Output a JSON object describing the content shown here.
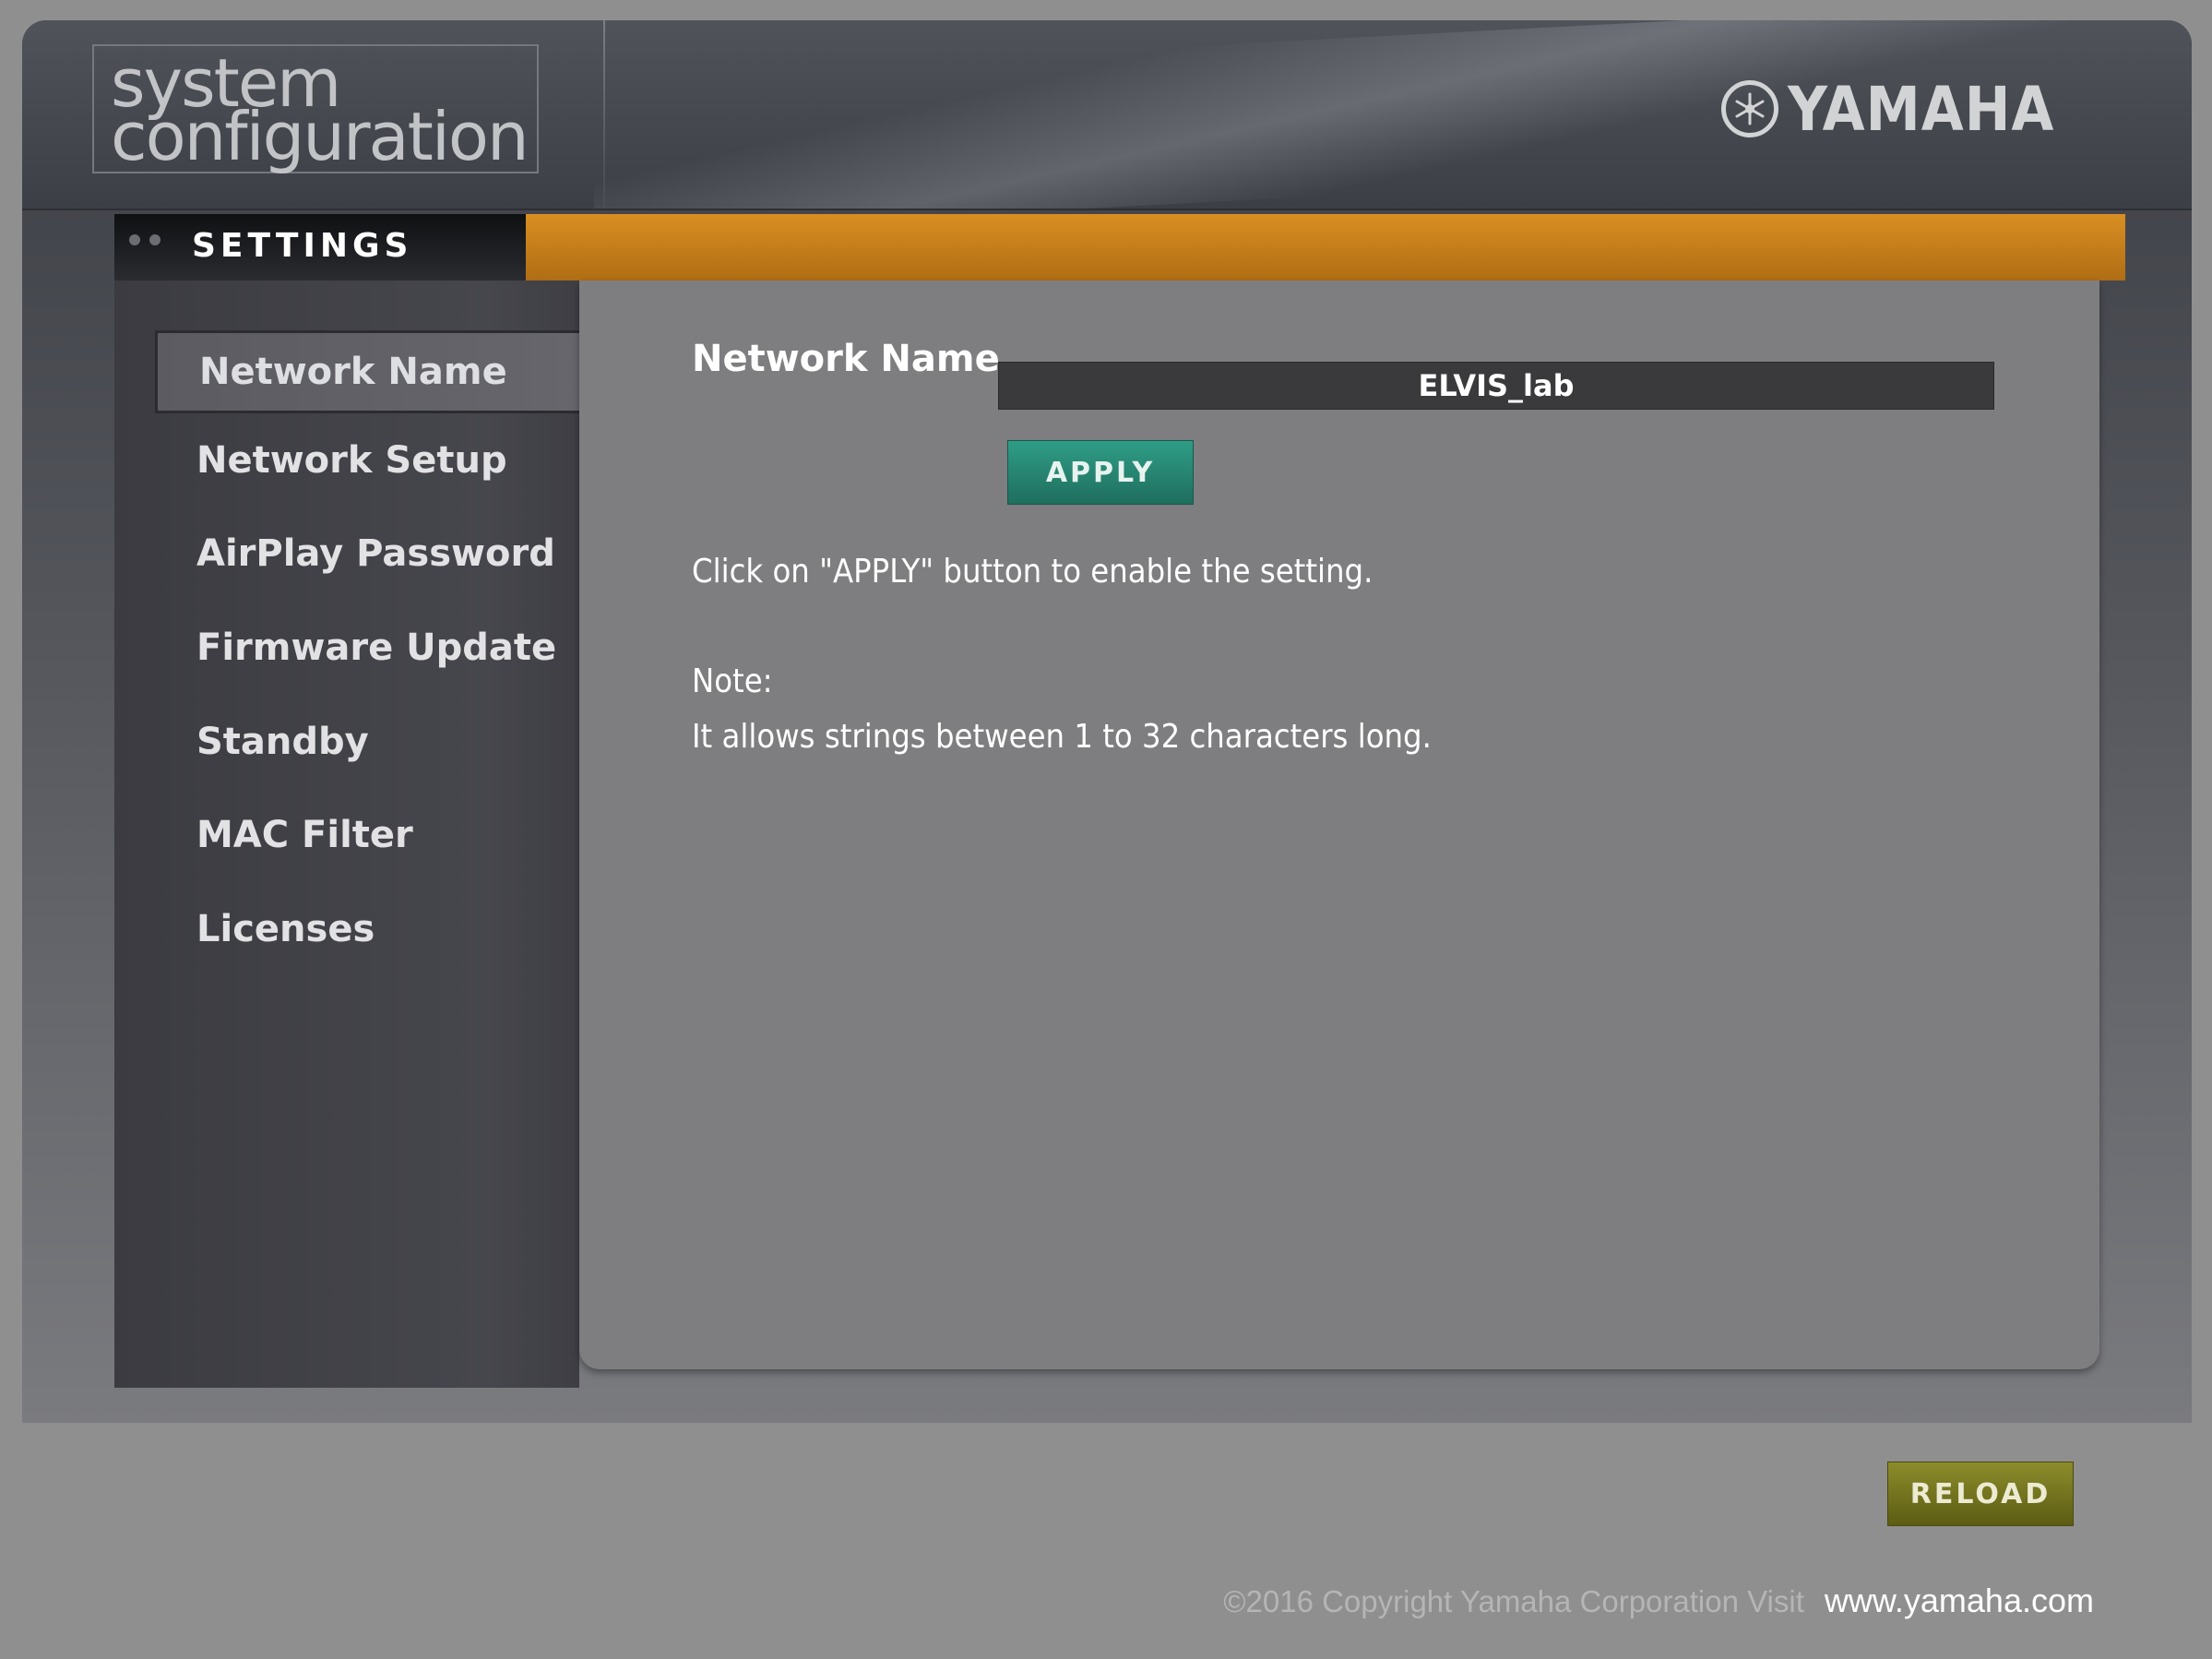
{
  "header": {
    "logo_line1": "system",
    "logo_line2": "configuration",
    "brand": "YAMAHA"
  },
  "titlebar": {
    "title": "SETTINGS"
  },
  "sidebar": {
    "items": [
      {
        "label": "Network Name",
        "active": true
      },
      {
        "label": "Network Setup"
      },
      {
        "label": "AirPlay Password"
      },
      {
        "label": "Firmware Update"
      },
      {
        "label": "Standby"
      },
      {
        "label": "MAC Filter"
      },
      {
        "label": "Licenses"
      }
    ]
  },
  "content": {
    "field_label": "Network Name",
    "field_value": "ELVIS_lab",
    "apply_label": "APPLY",
    "instruction": "Click on \"APPLY\" button to enable the setting.",
    "note_title": "Note:",
    "note_text": "It allows strings between 1 to 32 characters long."
  },
  "actions": {
    "reload_label": "RELOAD"
  },
  "footer": {
    "copyright": "©2016 Copyright Yamaha Corporation Visit",
    "link_text": "www.yamaha.com"
  },
  "colors": {
    "accent_orange": "#d88f22",
    "apply_green": "#2f9d86",
    "reload_olive": "#8c8c2c"
  },
  "icons": {
    "brand_emblem": "tuning-fork-emblem-icon",
    "title_dots": "window-dots-icon"
  }
}
